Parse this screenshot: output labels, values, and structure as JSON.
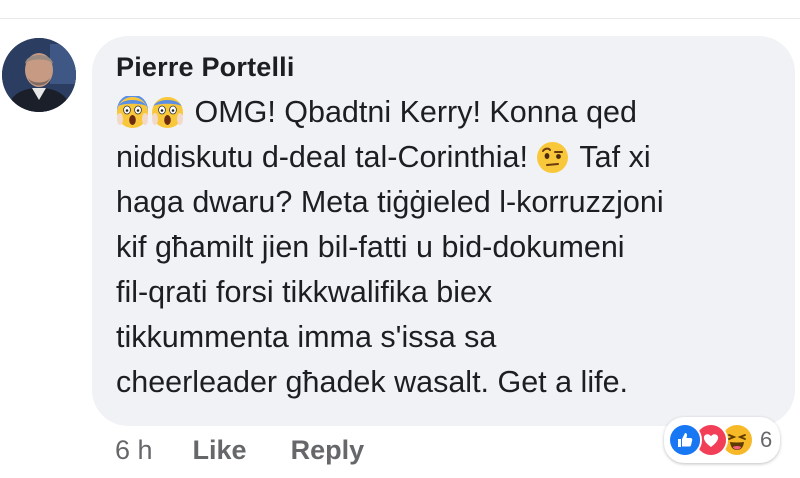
{
  "comment": {
    "author": "Pierre Portelli",
    "lines": [
      "OMG! Qbadtni Kerry! Konna qed",
      "niddiskutu d-deal tal-Corinthia!",
      "Taf xi",
      "haga dwaru? Meta tiġġieled l-korruzzjoni",
      "kif għamilt jien bil-fatti u bid-dokumeni",
      "fil-qrati forsi tikkwalifika biex",
      "tikkummenta imma s'issa sa",
      "cheerleader għadek wasalt. Get a life."
    ],
    "inline_emojis": [
      "screaming-face-emoji",
      "screaming-face-emoji",
      "face-with-raised-eyebrow-emoji"
    ]
  },
  "meta": {
    "time": "6 h",
    "like_label": "Like",
    "reply_label": "Reply"
  },
  "reactions": {
    "icons": [
      "like-reaction-icon",
      "love-reaction-icon",
      "haha-reaction-icon"
    ],
    "count": "6",
    "colors": {
      "like": "#1877f2",
      "love": "#f33e58",
      "haha": "#f7b928"
    }
  }
}
